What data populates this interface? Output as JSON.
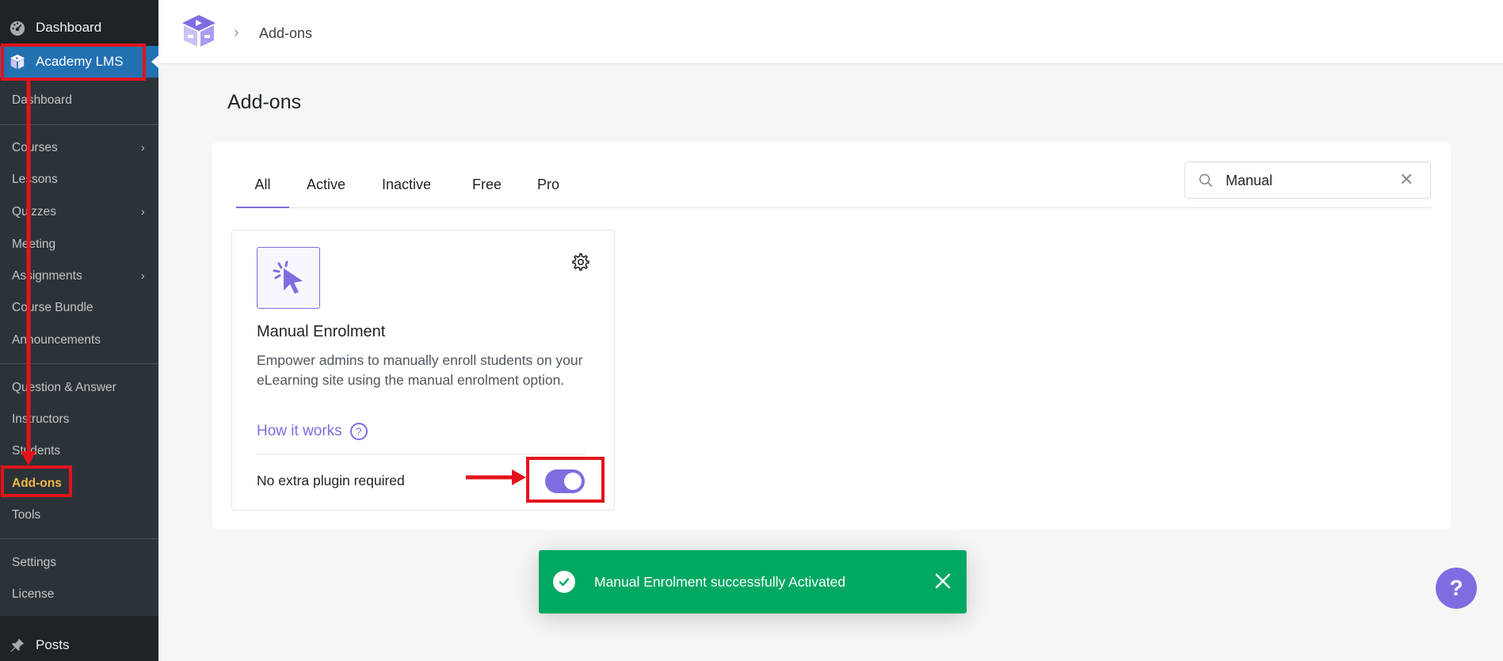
{
  "sidebar": {
    "dashboard_label": "Dashboard",
    "academy_label": "Academy LMS",
    "items": [
      {
        "label": "Dashboard",
        "has_chevron": false
      },
      {
        "label": "Courses",
        "has_chevron": true
      },
      {
        "label": "Lessons",
        "has_chevron": false
      },
      {
        "label": "Quizzes",
        "has_chevron": true
      },
      {
        "label": "Meeting",
        "has_chevron": false
      },
      {
        "label": "Assignments",
        "has_chevron": true
      },
      {
        "label": "Course Bundle",
        "has_chevron": false
      },
      {
        "label": "Announcements",
        "has_chevron": false
      },
      {
        "label": "Question & Answer",
        "has_chevron": false
      },
      {
        "label": "Instructors",
        "has_chevron": false
      },
      {
        "label": "Students",
        "has_chevron": false
      },
      {
        "label": "Add-ons",
        "has_chevron": false,
        "current": true
      },
      {
        "label": "Tools",
        "has_chevron": false
      },
      {
        "label": "Settings",
        "has_chevron": false
      },
      {
        "label": "License",
        "has_chevron": false
      }
    ],
    "posts_label": "Posts"
  },
  "header": {
    "breadcrumb": "Add-ons"
  },
  "page": {
    "title": "Add-ons"
  },
  "tabs": [
    "All",
    "Active",
    "Inactive",
    "Free",
    "Pro"
  ],
  "active_tab": "All",
  "search": {
    "value": "Manual",
    "clear_icon": "close-icon"
  },
  "card": {
    "title": "Manual Enrolment",
    "description": "Empower admins to manually enroll students on your eLearning site using the manual enrolment option.",
    "how_it_works": "How it works",
    "footer": "No extra plugin required",
    "toggle_on": true
  },
  "toast": {
    "message": "Manual Enrolment successfully Activated"
  },
  "help_label": "?",
  "colors": {
    "accent": "#7f6ce0",
    "toast": "#00a862",
    "sidebar": "#1d2327",
    "highlight": "#e4131b"
  }
}
